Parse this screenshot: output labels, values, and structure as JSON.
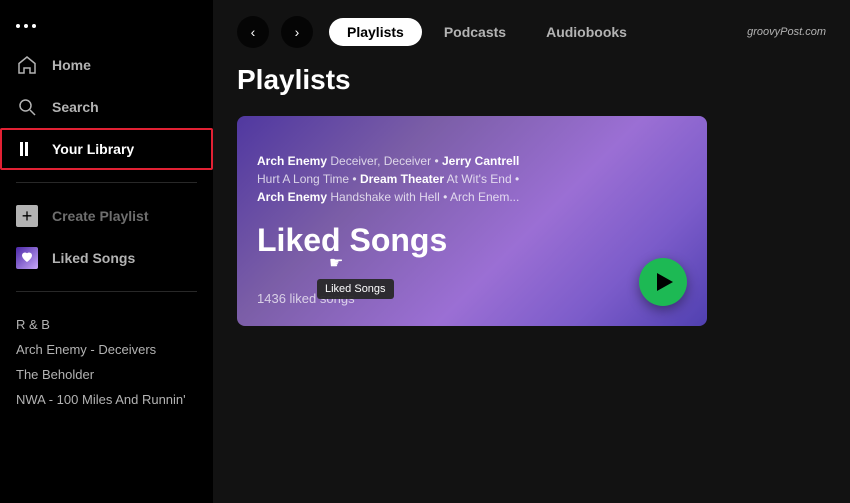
{
  "sidebar": {
    "dots_label": "···",
    "nav": [
      {
        "id": "home",
        "label": "Home"
      },
      {
        "id": "search",
        "label": "Search"
      },
      {
        "id": "your-library",
        "label": "Your Library",
        "active": true
      }
    ],
    "create_playlist_label": "Create Playlist",
    "liked_songs_label": "Liked Songs",
    "playlists": [
      {
        "label": "R & B"
      },
      {
        "label": "Arch Enemy - Deceivers"
      },
      {
        "label": "The Beholder"
      },
      {
        "label": "NWA - 100 Miles And Runnin'"
      }
    ]
  },
  "topbar": {
    "back_label": "‹",
    "forward_label": "›",
    "tabs": [
      {
        "id": "playlists",
        "label": "Playlists",
        "active": true
      },
      {
        "id": "podcasts",
        "label": "Podcasts",
        "active": false
      },
      {
        "id": "audiobooks",
        "label": "Audiobooks",
        "active": false
      }
    ],
    "watermark": "groovyPost.com"
  },
  "content": {
    "section_title": "Playlists",
    "card": {
      "text_line1_artist1": "Arch Enemy",
      "text_line1_song1": "Deceiver, Deceiver",
      "text_line1_sep1": " • ",
      "text_line1_artist2": "Jerry Cantrell",
      "text_line2_song1": "Hurt A Long Time",
      "text_line2_sep1": " • ",
      "text_line2_artist2": "Dream Theater",
      "text_line2_song2": "At Wit's End",
      "text_line2_sep2": " • ",
      "text_line3_artist1": "Arch Enemy",
      "text_line3_song1": "Handshake with Hell",
      "text_line3_sep1": " • ",
      "text_line3_ellipsis": "Arch Enem...",
      "title": "Liked Songs",
      "tooltip": "Liked Songs",
      "subtitle": "1436 liked songs",
      "play_label": "▶"
    }
  }
}
